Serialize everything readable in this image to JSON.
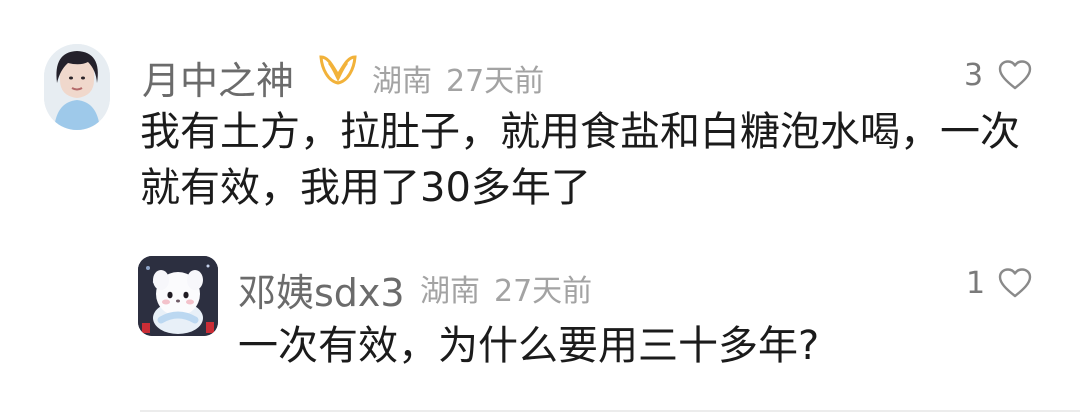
{
  "comments": [
    {
      "author": "月中之神",
      "location": "湖南",
      "time": "27天前",
      "likes": "3",
      "text_line1": "我有土方，拉肚子，就用食盐和白糖泡水喝，一次",
      "text_line2": "就有效，我用了30多年了",
      "badge_icon": "vip-badge-icon",
      "accent_color": "#f2b23a"
    },
    {
      "author": "邓姨sdx3",
      "location": "湖南",
      "time": "27天前",
      "likes": "1",
      "text": "一次有效，为什么要用三十多年?"
    }
  ],
  "icons": {
    "like": "heart-outline-icon",
    "badge": "vip-badge-icon"
  }
}
